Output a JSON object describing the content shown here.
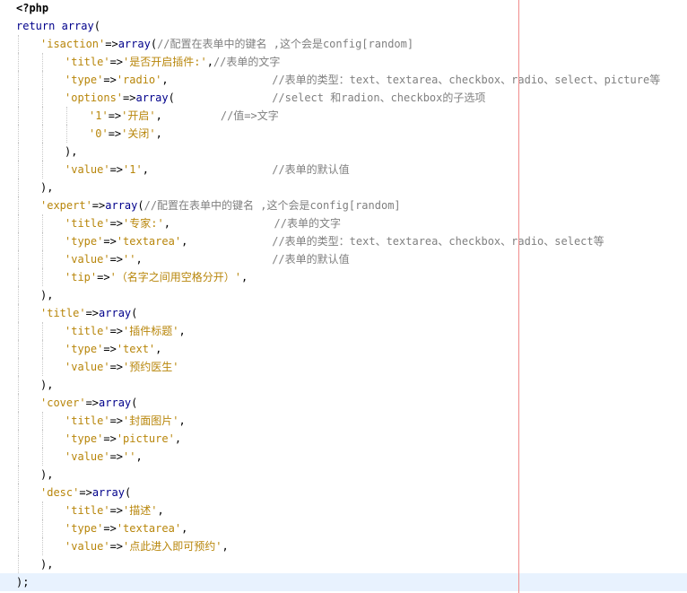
{
  "editor": {
    "language": "php",
    "colors": {
      "keyword": "#00008b",
      "string": "#b8860b",
      "comment": "#808080",
      "text": "#000000",
      "current_line": "#e8f2fe",
      "margin_line": "#f08c8c",
      "indent_guide": "#c8c8c8"
    },
    "lines": [
      {
        "text": "<?php",
        "indent": 0
      },
      {
        "text": "return array(",
        "indent": 0
      },
      {
        "text": "'isaction'=>array(//配置在表单中的键名 ,这个会是config[random]",
        "indent": 1
      },
      {
        "text": "'title'=>'是否开启插件:',//表单的文字",
        "indent": 2
      },
      {
        "text": "'type'=>'radio',                //表单的类型：text、textarea、checkbox、radio、select、picture等",
        "indent": 2
      },
      {
        "text": "'options'=>array(               //select 和radion、checkbox的子选项",
        "indent": 2
      },
      {
        "text": "'1'=>'开启',         //值=>文字",
        "indent": 3
      },
      {
        "text": "'0'=>'关闭',",
        "indent": 3
      },
      {
        "text": "),",
        "indent": 2
      },
      {
        "text": "'value'=>'1',                   //表单的默认值",
        "indent": 2
      },
      {
        "text": "),",
        "indent": 1
      },
      {
        "text": "'expert'=>array(//配置在表单中的键名 ,这个会是config[random]",
        "indent": 1
      },
      {
        "text": "'title'=>'专家:',                //表单的文字",
        "indent": 2
      },
      {
        "text": "'type'=>'textarea',             //表单的类型：text、textarea、checkbox、radio、select等",
        "indent": 2
      },
      {
        "text": "'value'=>'',                    //表单的默认值",
        "indent": 2
      },
      {
        "text": "'tip'=>'（名字之间用空格分开）',",
        "indent": 2
      },
      {
        "text": "),",
        "indent": 1
      },
      {
        "text": "'title'=>array(",
        "indent": 1
      },
      {
        "text": "'title'=>'插件标题',",
        "indent": 2
      },
      {
        "text": "'type'=>'text',",
        "indent": 2
      },
      {
        "text": "'value'=>'预约医生'",
        "indent": 2
      },
      {
        "text": "),",
        "indent": 1
      },
      {
        "text": "'cover'=>array(",
        "indent": 1
      },
      {
        "text": "'title'=>'封面图片',",
        "indent": 2
      },
      {
        "text": "'type'=>'picture',",
        "indent": 2
      },
      {
        "text": "'value'=>'',",
        "indent": 2
      },
      {
        "text": "),",
        "indent": 1
      },
      {
        "text": "'desc'=>array(",
        "indent": 1
      },
      {
        "text": "'title'=>'描述',",
        "indent": 2
      },
      {
        "text": "'type'=>'textarea',",
        "indent": 2
      },
      {
        "text": "'value'=>'点此进入即可预约',",
        "indent": 2
      },
      {
        "text": "),",
        "indent": 1
      },
      {
        "text": ");",
        "indent": 0,
        "current": true
      }
    ]
  }
}
